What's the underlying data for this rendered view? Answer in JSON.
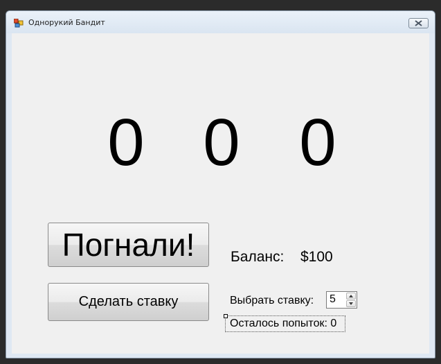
{
  "window": {
    "title": "Однорукий Бандит"
  },
  "reels": [
    "0",
    "0",
    "0"
  ],
  "buttons": {
    "spin": "Погнали!",
    "bet": "Сделать ставку"
  },
  "balance": {
    "label": "Баланс:",
    "value": "$100"
  },
  "bet": {
    "label": "Выбрать ставку:",
    "value": "5"
  },
  "attempts": {
    "text": "Осталось попыток: 0"
  },
  "icons": {
    "app": "app-icon",
    "close": "close-icon",
    "up": "chevron-up-icon",
    "down": "chevron-down-icon"
  }
}
